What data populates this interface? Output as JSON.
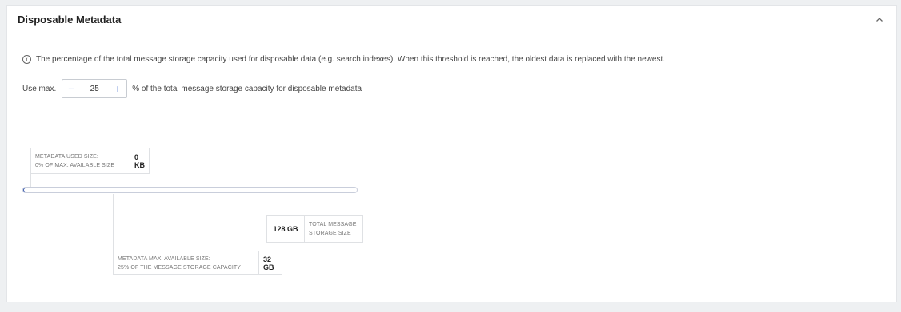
{
  "panel": {
    "title": "Disposable Metadata",
    "collapse_icon": "chevron-up-icon"
  },
  "info": {
    "icon": "info-icon",
    "text": "The percentage of the total message storage capacity used for disposable data (e.g. search indexes). When this threshold is reached, the oldest data is replaced with the newest."
  },
  "limit": {
    "prefix": "Use max.",
    "value": "25",
    "suffix": "% of the total message storage capacity for disposable metadata",
    "decrement_symbol": "−",
    "increment_symbol": "+"
  },
  "usage": {
    "used_label_line1": "METADATA USED SIZE:",
    "used_label_line2": "0% OF MAX. AVAILABLE SIZE",
    "used_value": "0 KB",
    "total_value": "128 GB",
    "total_label_line1": "TOTAL MESSAGE",
    "total_label_line2": "STORAGE SIZE",
    "max_label_line1": "METADATA MAX. AVAILABLE SIZE:",
    "max_label_line2": "25% OF THE MESSAGE STORAGE CAPACITY",
    "max_value": "32 GB",
    "max_fraction_of_total": 0.25,
    "used_fraction_of_max": 0
  },
  "colors": {
    "accent": "#2c5cc5",
    "bar_border": "#c9cedb"
  }
}
